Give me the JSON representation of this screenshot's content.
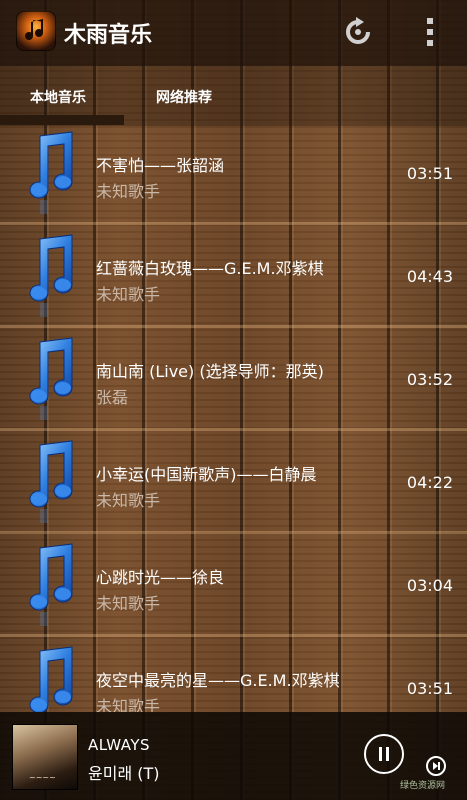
{
  "app": {
    "title": "木雨音乐"
  },
  "toolbar": {
    "refresh_icon": "refresh-icon",
    "more_icon": "more-vertical-icon"
  },
  "tabs": [
    {
      "label": "本地音乐",
      "active": true
    },
    {
      "label": "网络推荐",
      "active": false
    }
  ],
  "songs": [
    {
      "title": "不害怕——张韶涵",
      "artist": "未知歌手",
      "duration": "03:51"
    },
    {
      "title": "红蔷薇白玫瑰——G.E.M.邓紫棋",
      "artist": "未知歌手",
      "duration": "04:43"
    },
    {
      "title": "南山南 (Live) (选择导师：那英)",
      "artist": "张磊",
      "duration": "03:52"
    },
    {
      "title": "小幸运(中国新歌声)——白静晨",
      "artist": "未知歌手",
      "duration": "04:22"
    },
    {
      "title": "心跳时光——徐良",
      "artist": "未知歌手",
      "duration": "03:04"
    },
    {
      "title": "夜空中最亮的星——G.E.M.邓紫棋",
      "artist": "未知歌手",
      "duration": "03:51"
    }
  ],
  "player": {
    "title": "ALWAYS",
    "artist": "윤미래 (T)",
    "play_icon": "pause-icon",
    "next_icon": "next-track-icon"
  },
  "watermark": "绿色资源网"
}
